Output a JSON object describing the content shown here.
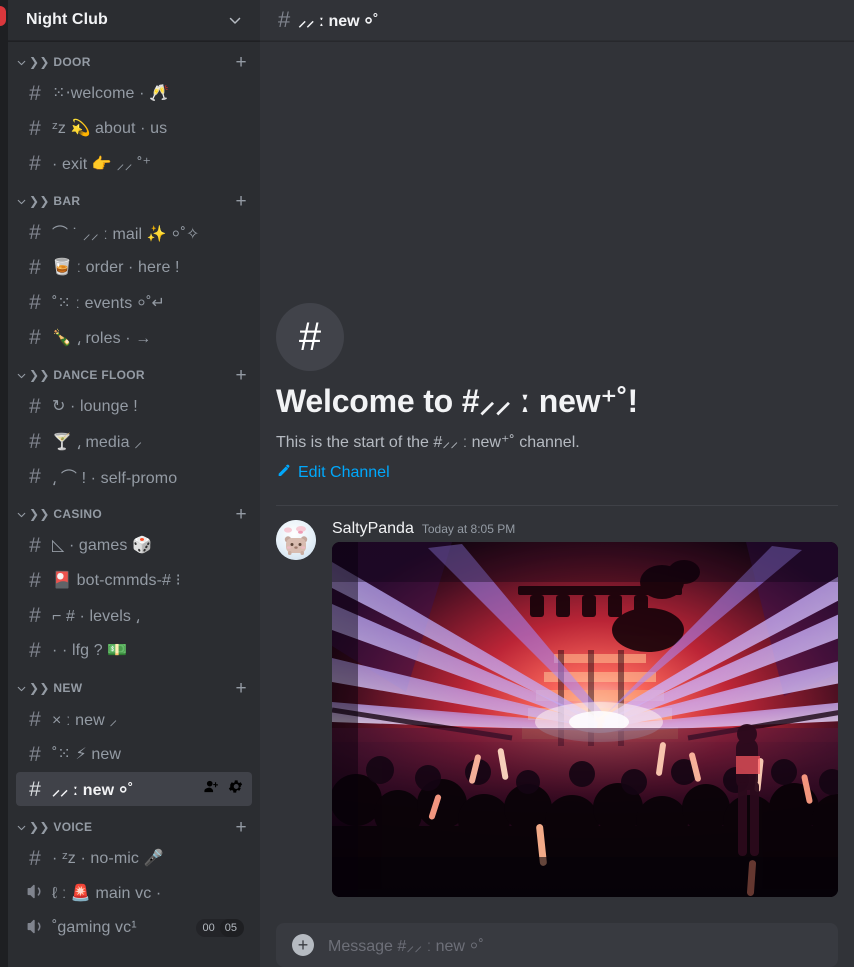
{
  "app": {
    "accent_blue": "#00a8fc",
    "sidebar_bg": "#2b2d31",
    "main_bg": "#313338",
    "badge_red": "#da373c"
  },
  "guild": {
    "name": "Night Club",
    "collapse_icon": "chevron-down-icon"
  },
  "categories": [
    {
      "name": "❯❯ DOOR",
      "add_label": "+",
      "channels": [
        {
          "icon": "#",
          "name": "⁙⋅welcome ·  🥂"
        },
        {
          "icon": "#",
          "name": "ᶻz 💫 about ·  us"
        },
        {
          "icon": "#",
          "name": " · exit 👉 ⸝⸝ ˚⁺"
        }
      ]
    },
    {
      "name": "❯❯ BAR",
      "add_label": "+",
      "channels": [
        {
          "icon": "#",
          "name": " ⌒ ˙ ⸝⸝ ː mail ✨ ⸰˚✧"
        },
        {
          "icon": "#",
          "name": "🥃 ː order ·  here !"
        },
        {
          "icon": "#",
          "name": "˚⁙ ː events ⸰˚↵"
        },
        {
          "icon": "#",
          "name": "🍾 ⸲ roles  ·  →"
        }
      ]
    },
    {
      "name": "❯❯ DANCE FLOOR",
      "add_label": "+",
      "channels": [
        {
          "icon": "#",
          "name": "↻ ·  lounge !"
        },
        {
          "icon": "#",
          "name": "🍸 ⸲  media  ⸝"
        },
        {
          "icon": "#",
          "name": " ⸲  ⌒ ! · self-promo"
        }
      ]
    },
    {
      "name": "❯❯ CASINO",
      "add_label": "+",
      "channels": [
        {
          "icon": "#",
          "name": "◺ ·  games 🎲"
        },
        {
          "icon": "#",
          "name": "🎴 bot-cmmds-# ⁝"
        },
        {
          "icon": "#",
          "name": "⌐ # ·  levels ⸲"
        },
        {
          "icon": "#",
          "name": " ·  ·  lfg ? 💵"
        }
      ]
    },
    {
      "name": "❯❯ NEW",
      "add_label": "+",
      "channels": [
        {
          "icon": "#",
          "name": "× ː new ⸝"
        },
        {
          "icon": "#",
          "name": "˚⁙ ⚡ new"
        },
        {
          "icon": "#",
          "name": "⸝⸝ ː new ⸰˚",
          "active": true,
          "actions": [
            "person-add-icon",
            "gear-icon"
          ]
        }
      ]
    },
    {
      "name": "❯❯ VOICE",
      "add_label": "+",
      "channels": [
        {
          "icon": "#",
          "name": " · ᶻz ·  no-mic 🎤"
        },
        {
          "icon": "speaker",
          "name": "ℓ ː 🚨 main vc ·"
        },
        {
          "icon": "speaker",
          "name": "˚gaming vc¹",
          "vc_current": "00",
          "vc_max": "05"
        }
      ]
    }
  ],
  "channel_header": {
    "hash": "#",
    "title": "⸝⸝ ː new ⸰˚"
  },
  "welcome": {
    "hash_icon": "#",
    "title": "Welcome to #⸝⸝ ː new⁺˚!",
    "subtitle": "This is the start of the #⸝⸝ ː new⁺˚ channel.",
    "edit_label": "Edit Channel",
    "edit_icon": "pencil-icon"
  },
  "message": {
    "author": "SaltyPanda",
    "timestamp": "Today at 8:05 PM",
    "avatar_alt": "panda-avatar",
    "attachment_alt": "nightclub-laser-crowd-photo"
  },
  "composer": {
    "add_icon": "plus-circle-icon",
    "placeholder": "Message #⸝⸝ ː new ⸰˚"
  }
}
